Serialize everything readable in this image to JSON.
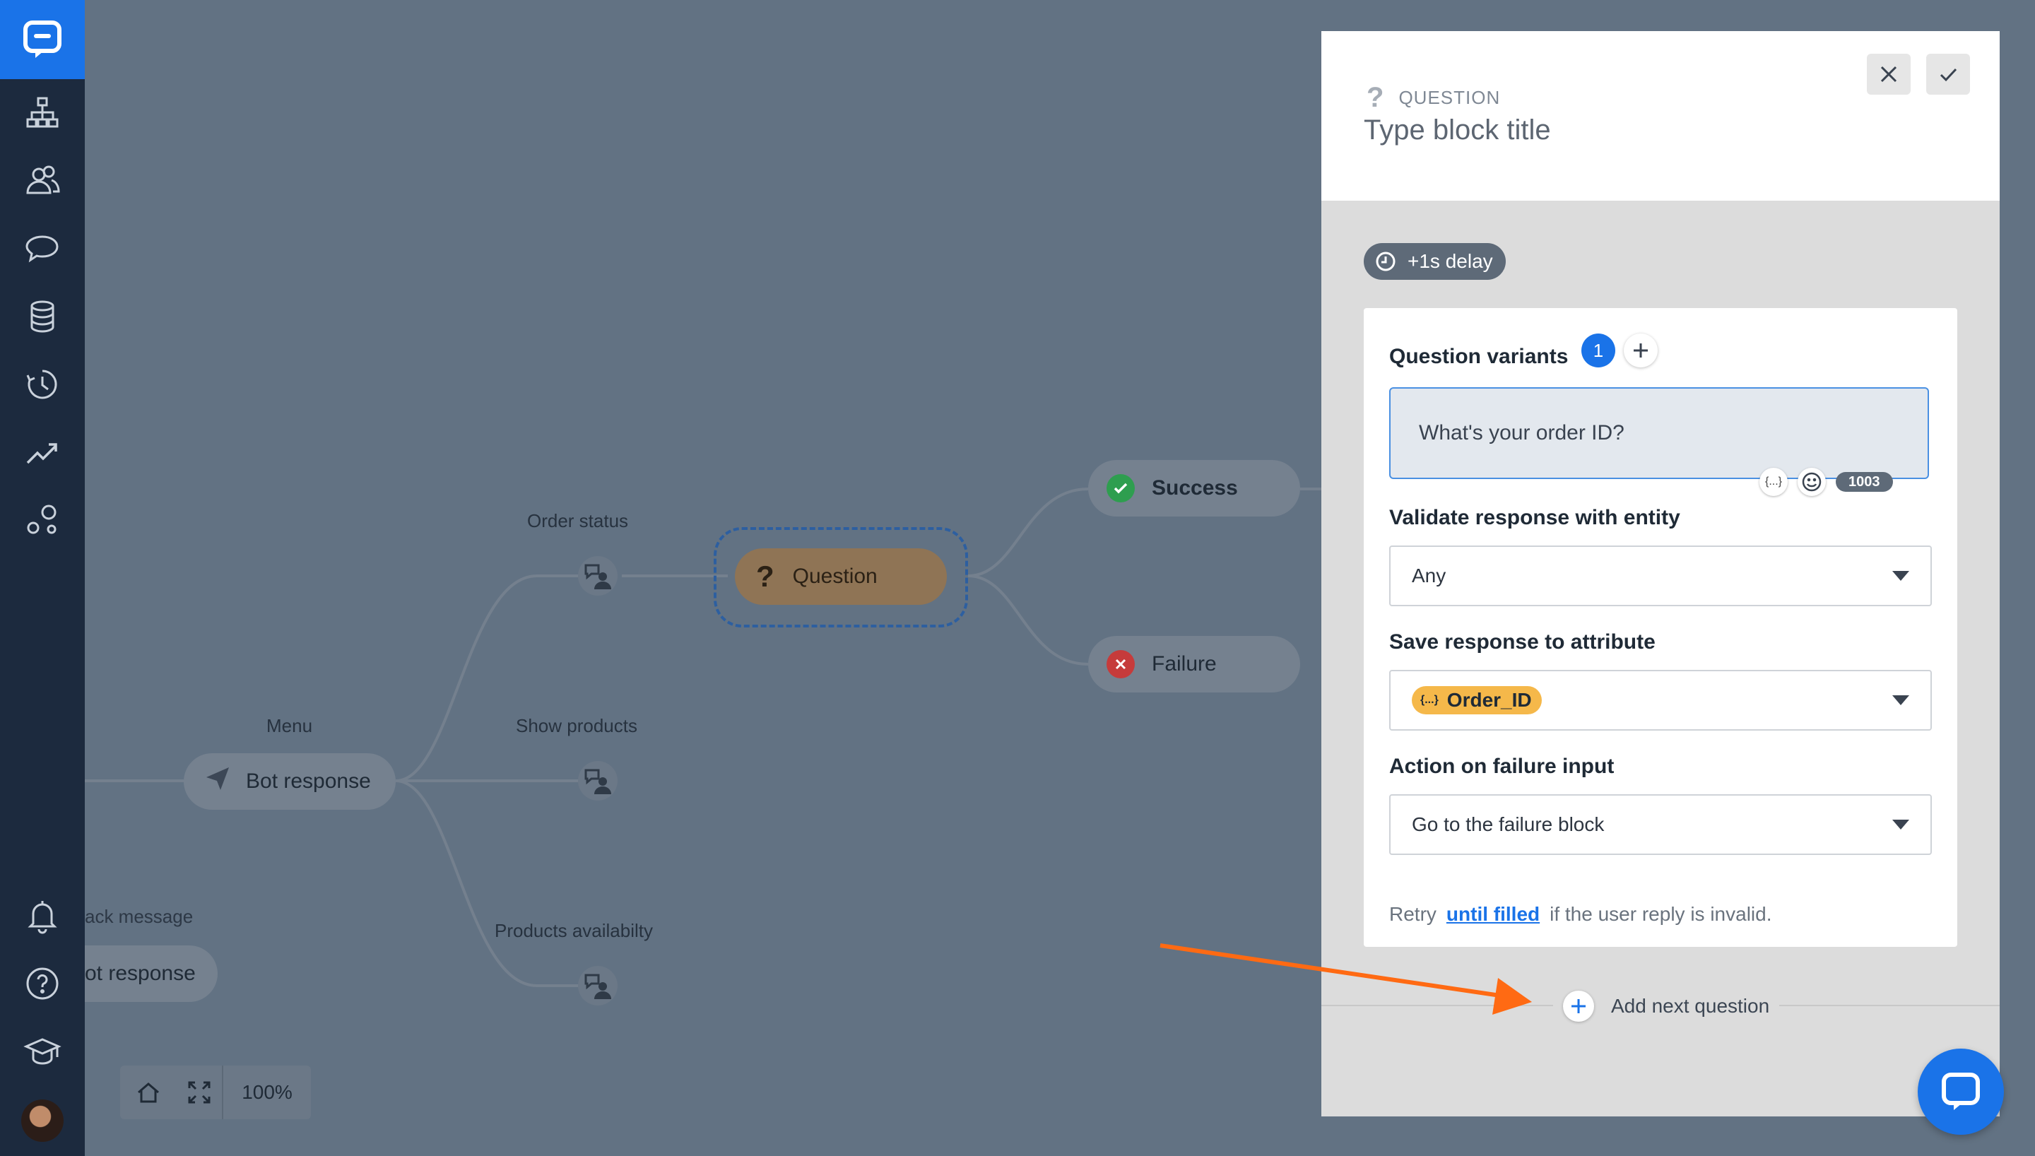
{
  "canvas": {
    "labels": {
      "menu": "Menu",
      "order_status": "Order status",
      "show_products": "Show products",
      "products_availability": "Products availabilty",
      "fallback_message": "ack message"
    },
    "nodes": {
      "bot_response": "Bot response",
      "bot_response_partial": "ot response",
      "question": "Question",
      "success": "Success",
      "failure": "Failure"
    },
    "zoom_level": "100%"
  },
  "panel": {
    "block_type": "QUESTION",
    "title_placeholder": "Type block title",
    "delay_badge": "+1s delay",
    "question_variants_label": "Question variants",
    "variant_count": "1",
    "question_text": "What's your order ID?",
    "char_count": "1003",
    "variable_tool": "{...}",
    "validate_label": "Validate response with entity",
    "validate_value": "Any",
    "save_label": "Save response to attribute",
    "attribute_chip_icon": "{...}",
    "attribute_value": "Order_ID",
    "failure_action_label": "Action on failure input",
    "failure_action_value": "Go to the failure block",
    "retry_prefix": "Retry",
    "retry_link": "until filled",
    "retry_suffix": "if the user reply is invalid.",
    "add_next_question": "Add next question"
  },
  "colors": {
    "accent": "#1a73e8",
    "sidebar": "#1c2a3e",
    "canvas_overlay": "#627283",
    "success": "#2e9e4f",
    "failure": "#c63b3b",
    "attribute_chip": "#f5b84a",
    "arrow": "#ff6a13"
  }
}
